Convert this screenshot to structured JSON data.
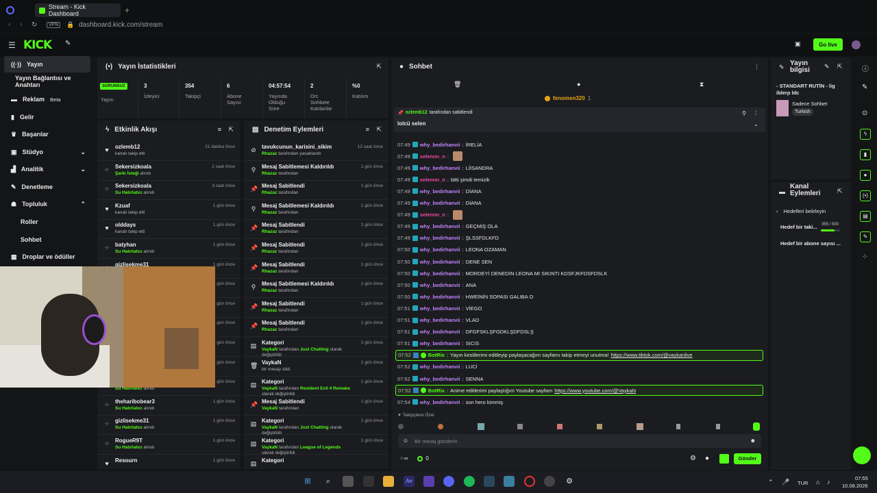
{
  "browser": {
    "tab_title": "Stream - Kick Dashboard",
    "url": "dashboard.kick.com/stream",
    "vpn": "VPN"
  },
  "topnav": {
    "logo": "KICK",
    "go_live": "Go live"
  },
  "sidebar": {
    "items": [
      {
        "label": "Yayın",
        "icon": "broadcast-icon",
        "active": true
      },
      {
        "label": "Yayın Bağlantısı ve Anahtarı",
        "sub": true
      },
      {
        "label": "Reklam",
        "icon": "ad-icon",
        "badge": "Beta"
      },
      {
        "label": "Gelir",
        "icon": "revenue-icon"
      },
      {
        "label": "Başarılar",
        "icon": "trophy-icon"
      },
      {
        "label": "Stüdyo",
        "icon": "studio-icon",
        "chevron": "down"
      },
      {
        "label": "Analitik",
        "icon": "analytics-icon",
        "chevron": "down"
      },
      {
        "label": "Denetleme",
        "icon": "wrench-icon"
      },
      {
        "label": "Topluluk",
        "icon": "community-icon",
        "chevron": "up"
      },
      {
        "label": "Roller",
        "sub": true
      },
      {
        "label": "Sohbet",
        "sub": true
      },
      {
        "label": "Droplar ve ödüller",
        "icon": "drops-icon"
      }
    ]
  },
  "stats": {
    "title": "Yayın İstatistikleri",
    "status": "SORUNSUZ",
    "status_label": "Yayın",
    "items": [
      {
        "value": "3",
        "label": "İzleyici"
      },
      {
        "value": "354",
        "label": "Takipçi"
      },
      {
        "value": "6",
        "label": "Abone Sayısı"
      },
      {
        "value": "04:57:54",
        "label": "Yayında Olduğu Süre"
      },
      {
        "value": "2",
        "label": "Ort. Sohbete Katılanlar"
      },
      {
        "value": "%0",
        "label": "Katılım"
      }
    ]
  },
  "activity": {
    "title": "Etkinlik Akışı",
    "rows": [
      {
        "name": "ozlemb12",
        "sub": "kanalı takip etti",
        "green": "",
        "time": "21 dakika önce",
        "icon": "heart-icon"
      },
      {
        "name": "Sekersizkoala",
        "sub": "alındı",
        "green": "Şarkı İsteği",
        "time": "2 saat önce",
        "icon": "points-icon"
      },
      {
        "name": "Sekersizkoala",
        "sub": "alındı",
        "green": "Su Hatırlatıcı",
        "time": "3 saat önce",
        "icon": "points-icon"
      },
      {
        "name": "Kzuaf",
        "sub": "kanalı takip etti",
        "green": "",
        "time": "1 gün önce",
        "icon": "heart-icon"
      },
      {
        "name": "olddays",
        "sub": "kanalı takip etti",
        "green": "",
        "time": "1 gün önce",
        "icon": "heart-icon"
      },
      {
        "name": "batyhan",
        "sub": "alındı",
        "green": "Su Hatırlatıcı",
        "time": "1 gün önce",
        "icon": "points-icon"
      },
      {
        "name": "gizlisekme31",
        "sub": "",
        "green": "",
        "time": "1 gün önce",
        "icon": "points-icon"
      },
      {
        "name": "",
        "sub": "",
        "green": "",
        "time": "1 gün önce",
        "icon": "points-icon"
      },
      {
        "name": "",
        "sub": "",
        "green": "",
        "time": "1 gün önce",
        "icon": "points-icon"
      },
      {
        "name": "",
        "sub": "",
        "green": "",
        "time": "1 gün önce",
        "icon": "points-icon"
      },
      {
        "name": "",
        "sub": "",
        "green": "",
        "time": "1 gün önce",
        "icon": "points-icon"
      },
      {
        "name": "",
        "sub": "",
        "green": "",
        "time": "1 gün önce",
        "icon": "points-icon"
      },
      {
        "name": "",
        "sub": "alındı",
        "green": "Su Hatırlatıcı",
        "time": "1 gün önce",
        "icon": "points-icon"
      },
      {
        "name": "theharibobear3",
        "sub": "alındı",
        "green": "Su Hatırlatıcı",
        "time": "1 gün önce",
        "icon": "points-icon"
      },
      {
        "name": "gizlisekme31",
        "sub": "alındı",
        "green": "Su Hatırlatıcı",
        "time": "1 gün önce",
        "icon": "points-icon"
      },
      {
        "name": "RogueR9T",
        "sub": "alındı",
        "green": "Su Hatırlatıcı",
        "time": "1 gün önce",
        "icon": "points-icon"
      },
      {
        "name": "Resourn",
        "sub": "",
        "green": "",
        "time": "1 gün önce",
        "icon": "heart-icon"
      }
    ]
  },
  "moderation": {
    "title": "Denetim Eylemleri",
    "rows": [
      {
        "name": "tavukcunun_karisini_sikim",
        "green": "Rhazaz",
        "sub": "tarafından yasaklandı",
        "time": "12 saat önce",
        "icon": "ban-icon"
      },
      {
        "name": "Mesaj Sabitlemesi Kaldırıldı",
        "green": "Rhazaz",
        "sub": "tarafından",
        "time": "1 gün önce",
        "icon": "unpin-icon"
      },
      {
        "name": "Mesaj Sabitlendi",
        "green": "Rhazaz",
        "sub": "tarafından",
        "time": "1 gün önce",
        "icon": "pin-icon"
      },
      {
        "name": "Mesaj Sabitlemesi Kaldırıldı",
        "green": "Rhazaz",
        "sub": "tarafından",
        "time": "1 gün önce",
        "icon": "unpin-icon"
      },
      {
        "name": "Mesaj Sabitlendi",
        "green": "Rhazaz",
        "sub": "tarafından",
        "time": "1 gün önce",
        "icon": "pin-icon"
      },
      {
        "name": "Mesaj Sabitlendi",
        "green": "Rhazaz",
        "sub": "tarafından",
        "time": "1 gün önce",
        "icon": "pin-icon"
      },
      {
        "name": "Mesaj Sabitlendi",
        "green": "Rhazaz",
        "sub": "tarafından",
        "time": "1 gün önce",
        "icon": "pin-icon"
      },
      {
        "name": "Mesaj Sabitlemesi Kaldırıldı",
        "green": "Rhazaz",
        "sub": "tarafından",
        "time": "1 gün önce",
        "icon": "unpin-icon"
      },
      {
        "name": "Mesaj Sabitlendi",
        "green": "Rhazaz",
        "sub": "tarafından",
        "time": "1 gün önce",
        "icon": "pin-icon"
      },
      {
        "name": "Mesaj Sabitlendi",
        "green": "Rhazaz",
        "sub": "tarafından",
        "time": "1 gün önce",
        "icon": "pin-icon"
      },
      {
        "name": "Kategori",
        "green": "VaykaN",
        "sub": "tarafından",
        "green2": "Just Chatting",
        "sub2": "olarak değiştirildi",
        "time": "1 gün önce",
        "icon": "category-icon"
      },
      {
        "name": "VaykaN",
        "green": "",
        "sub": "bir mesajı sildi",
        "time": "1 gün önce",
        "icon": "trash-icon"
      },
      {
        "name": "Kategori",
        "green": "VaykaN",
        "sub": "tarafından",
        "green2": "Resident Evil 4 Remake",
        "sub2": "olarak değiştirildi",
        "time": "1 gün önce",
        "icon": "category-icon"
      },
      {
        "name": "Mesaj Sabitlendi",
        "green": "VaykaN",
        "sub": "tarafından",
        "time": "1 gün önce",
        "icon": "pin-icon"
      },
      {
        "name": "Kategori",
        "green": "VaykaN",
        "sub": "tarafından",
        "green2": "Just Chatting",
        "sub2": "olarak değiştirildi",
        "time": "1 gün önce",
        "icon": "category-icon"
      },
      {
        "name": "Kategori",
        "green": "VaykaN",
        "sub": "tarafından",
        "green2": "League of Legends",
        "sub2": "olarak değiştirildi",
        "time": "1 gün önce",
        "icon": "category-icon"
      },
      {
        "name": "Kategori",
        "green": "",
        "sub": "",
        "time": "",
        "icon": "category-icon"
      }
    ]
  },
  "chat": {
    "title": "Sohbet",
    "top_user": "fenomen320",
    "top_count": "1",
    "pinned_by": "ozlemb12",
    "pinned_suffix": "tarafından sabitlendi",
    "pinned_text": "lolcü selen",
    "messages": [
      {
        "ts": "07:49",
        "user": "why_bedirhanvii",
        "color": "#c084fc",
        "msg": "İRELİA"
      },
      {
        "ts": "07:49",
        "user": "selennn_n",
        "color": "#ef4aa3",
        "msg": "",
        "emote": true
      },
      {
        "ts": "07:49",
        "user": "why_bedirhanvii",
        "color": "#c084fc",
        "msg": "LİİSANDRA"
      },
      {
        "ts": "07:49",
        "user": "selennn_n",
        "color": "#ef4aa3",
        "msg": "bitti şimdi temizik"
      },
      {
        "ts": "07:49",
        "user": "why_bedirhanvii",
        "color": "#c084fc",
        "msg": "DİANA"
      },
      {
        "ts": "07:49",
        "user": "why_bedirhanvii",
        "color": "#c084fc",
        "msg": "DİANA"
      },
      {
        "ts": "07:49",
        "user": "selennn_n",
        "color": "#ef4aa3",
        "msg": "",
        "emote": true
      },
      {
        "ts": "07:49",
        "user": "why_bedirhanvii",
        "color": "#c084fc",
        "msg": "GEÇMİŞ OLA"
      },
      {
        "ts": "07:49",
        "user": "why_bedirhanvii",
        "color": "#c084fc",
        "msg": "ŞLSSFDLKFD"
      },
      {
        "ts": "07:50",
        "user": "why_bedirhanvii",
        "color": "#c084fc",
        "msg": "LEONA OZAMAN"
      },
      {
        "ts": "07:50",
        "user": "why_bedirhanvii",
        "color": "#c084fc",
        "msg": "DENE SEN"
      },
      {
        "ts": "07:50",
        "user": "why_bedirhanvii",
        "color": "#c084fc",
        "msg": "MORDEYİ DENEDİN LEONA MI SIKINTI KDSFJKFDSFDSLK"
      },
      {
        "ts": "07:50",
        "user": "why_bedirhanvii",
        "color": "#c084fc",
        "msg": "ANA"
      },
      {
        "ts": "07:50",
        "user": "why_bedirhanvii",
        "color": "#c084fc",
        "msg": "HWEİNİN SOPASI GALIBA O"
      },
      {
        "ts": "07:51",
        "user": "why_bedirhanvii",
        "color": "#c084fc",
        "msg": "VİEGO"
      },
      {
        "ts": "07:51",
        "user": "why_bedirhanvii",
        "color": "#c084fc",
        "msg": "VLAD"
      },
      {
        "ts": "07:51",
        "user": "why_bedirhanvii",
        "color": "#c084fc",
        "msg": "DFGFSKLŞFGDKLŞDFDSLŞ"
      },
      {
        "ts": "07:51",
        "user": "why_bedirhanvii",
        "color": "#c084fc",
        "msg": "SICIS"
      },
      {
        "ts": "07:52",
        "user": "BotRix",
        "color": "#53fc18",
        "msg": "Yayın kesitlerimi editleyip paylaşacağım sayfamı takip etmeyi unutma!",
        "link": "https://www.tiktok.com/@vaykanlive",
        "highlight": true
      },
      {
        "ts": "07:52",
        "user": "why_bedirhanvii",
        "color": "#c084fc",
        "msg": "LUCİ"
      },
      {
        "ts": "07:52",
        "user": "why_bedirhanvii",
        "color": "#c084fc",
        "msg": "SENNA"
      },
      {
        "ts": "07:52",
        "user": "BotRix",
        "color": "#53fc18",
        "msg": "Anime editlerimi paylaştığım Youtube sayfam",
        "link": "https://www.youtube.com/@VaykaN",
        "highlight": true
      },
      {
        "ts": "07:54",
        "user": "why_bedirhanvii",
        "color": "#c084fc",
        "msg": "son hero kimmiş"
      }
    ],
    "followers_only": "Takipçilere Özel",
    "input_placeholder": "Bir mesaj gönderin",
    "points": "0",
    "send": "Gönder"
  },
  "stream_info": {
    "title": "Yayın bilgisi",
    "stream_title": "- STANDART RUTİN - lig iblerp ldc",
    "category": "Sadece Sohbet",
    "language": "Turkish"
  },
  "channel_actions": {
    "title": "Kanal Eylemleri",
    "back": "Hedefleri belirleyin",
    "goal1": "Hedef bir taki...",
    "goal1_progress": "355 / 500",
    "goal1_fraction": 0.71,
    "goal2": "Hedef bir abone sayısı ..."
  },
  "taskbar": {
    "lang": "TUR",
    "time": "07:55",
    "date": "10.08.2026"
  }
}
